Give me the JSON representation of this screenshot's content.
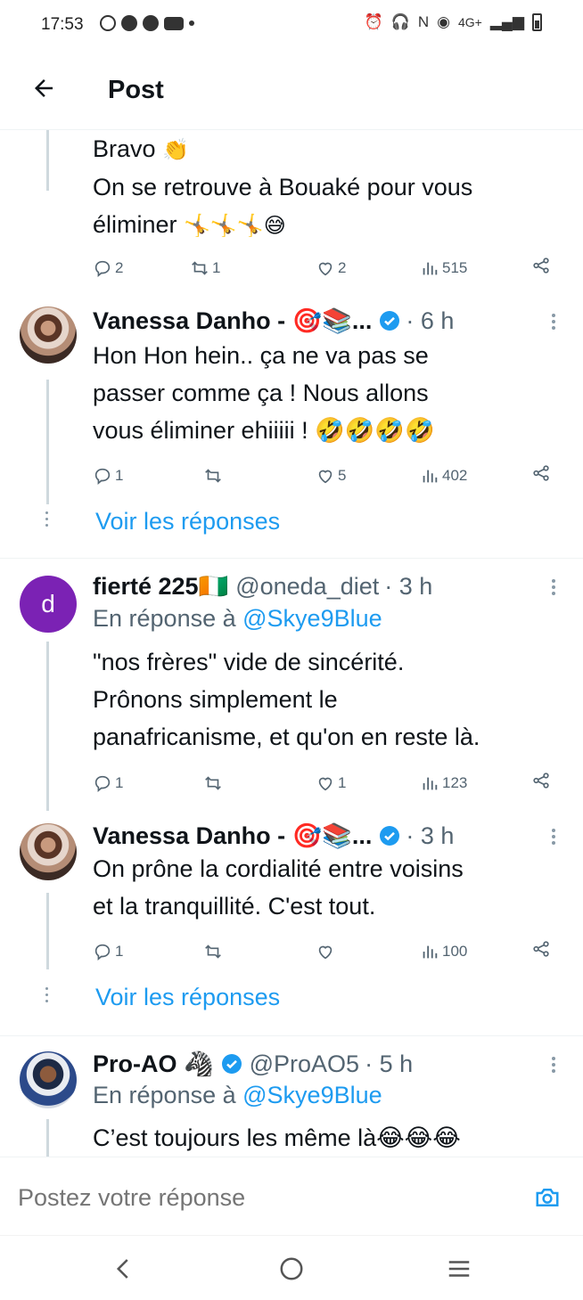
{
  "status_bar": {
    "time": "17:53",
    "network": "4G+"
  },
  "header": {
    "title": "Post"
  },
  "tweets": [
    {
      "text_lines": [
        "Bravo",
        "On se retrouve à Bouaké pour vous",
        "éliminer"
      ],
      "emojis": {
        "line1": "👏",
        "line3": "🤸🤸🤸😅"
      },
      "replies": "2",
      "retweets": "1",
      "likes": "2",
      "views": "515"
    },
    {
      "name": "Vanessa Danho - 🎯📚...",
      "time": "· 6 h",
      "text_lines": [
        "Hon Hon hein..  ça ne va pas se",
        "passer comme ça ! Nous allons",
        "vous éliminer ehiiiii ! 🤣🤣🤣🤣"
      ],
      "replies": "1",
      "retweets": "",
      "likes": "5",
      "views": "402"
    },
    {
      "avatar_letter": "d",
      "name": "fierté 225🇨🇮",
      "handle": "@oneda_diet",
      "time": "· 3 h",
      "reply_prefix": "En réponse à",
      "reply_mention": "@Skye9Blue",
      "text_lines": [
        "\"nos frères\" vide de sincérité.",
        "Prônons simplement le",
        "panafricanisme, et qu'on en reste là."
      ],
      "replies": "1",
      "retweets": "",
      "likes": "1",
      "views": "123"
    },
    {
      "name": "Vanessa Danho - 🎯📚...",
      "time": "· 3 h",
      "text_lines": [
        "On prône la cordialité entre voisins",
        "et la tranquillité. C'est tout."
      ],
      "replies": "1",
      "retweets": "",
      "likes": "",
      "views": "100"
    },
    {
      "name": "Pro-AO 🦓",
      "handle": "@ProAO5",
      "time": "· 5 h",
      "reply_prefix": "En réponse à",
      "reply_mention": "@Skye9Blue",
      "text_lines": [
        "C’est toujours les même là😂😂😂"
      ]
    }
  ],
  "show_replies_label": "Voir les réponses",
  "compose": {
    "placeholder": "Postez votre réponse"
  },
  "colors": {
    "accent": "#1d9bf0",
    "secondary_text": "#536471",
    "avatar_d": "#7b22b4"
  }
}
